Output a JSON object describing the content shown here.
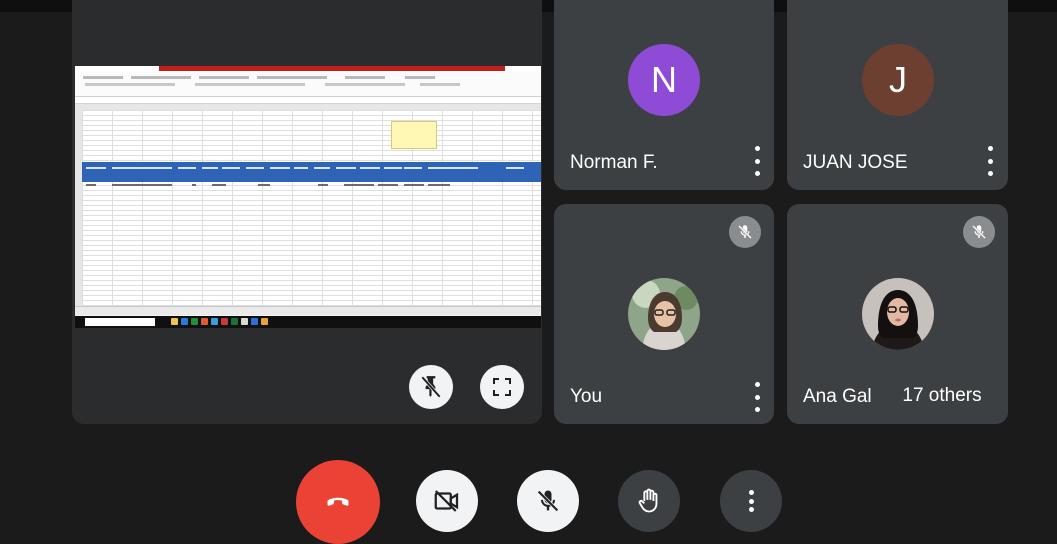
{
  "participants": [
    {
      "name": "Norman F.",
      "avatar_letter": "N",
      "avatar_color": "#8e4bd6"
    },
    {
      "name": "JUAN JOSE",
      "avatar_letter": "J",
      "avatar_color": "#6d3f31"
    },
    {
      "name": "You"
    },
    {
      "name": "Ana Gal"
    }
  ],
  "others_chip": "17 others",
  "colors": {
    "tile_bg": "#3c4043",
    "hangup": "#ea4335",
    "light_button": "#f1f3f4",
    "excel_header": "#2f63b6"
  },
  "icons": {
    "pin_off": "pin-off-icon",
    "fullscreen": "fullscreen-icon",
    "hangup": "phone-hangup-icon",
    "camera_off": "camera-off-icon",
    "mic_off": "mic-off-icon",
    "raise_hand": "raise-hand-icon",
    "more": "more-options-icon"
  }
}
